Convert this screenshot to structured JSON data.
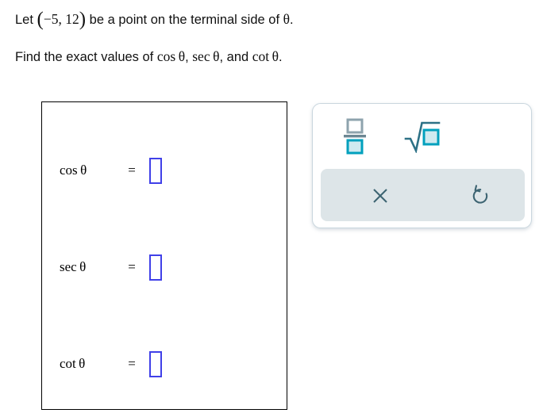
{
  "problem": {
    "line1": {
      "prefix": "Let ",
      "open_paren": "(",
      "point_x": "−5",
      "comma": ", ",
      "point_y": "12",
      "close_paren": ")",
      "suffix": " be a point on the terminal side of ",
      "theta": "θ",
      "period": "."
    },
    "line2": {
      "prefix": "Find the exact values of ",
      "fn1": "cos θ",
      "sep1": ", ",
      "fn2": "sec θ",
      "sep2": ", ",
      "conjunction": "and ",
      "fn3": "cot θ",
      "period": "."
    }
  },
  "answer_panel": {
    "rows": [
      {
        "label": "cos θ",
        "equals": "=",
        "value": "",
        "placeholder": ""
      },
      {
        "label": "sec θ",
        "equals": "=",
        "value": "",
        "placeholder": ""
      },
      {
        "label": "cot θ",
        "equals": "=",
        "value": "",
        "placeholder": ""
      }
    ],
    "input_border_color": "#4040e8"
  },
  "math_toolbar": {
    "symbol_buttons": [
      {
        "name": "fraction",
        "label": "Fraction",
        "icon": "fraction-icon"
      },
      {
        "name": "square-root",
        "label": "Square root",
        "icon": "square-root-icon"
      }
    ],
    "action_buttons": [
      {
        "name": "clear",
        "label": "Clear",
        "icon": "close-x-icon"
      },
      {
        "name": "undo",
        "label": "Undo",
        "icon": "undo-arrow-icon"
      }
    ],
    "colors": {
      "panel_border": "#c9d6de",
      "action_bar_bg": "#dde5e8",
      "icon_dark": "#3d6472",
      "accent_teal": "#00a0bd",
      "accent_fill": "#cfeaf0",
      "icon_gray": "#8ea3ad"
    }
  }
}
